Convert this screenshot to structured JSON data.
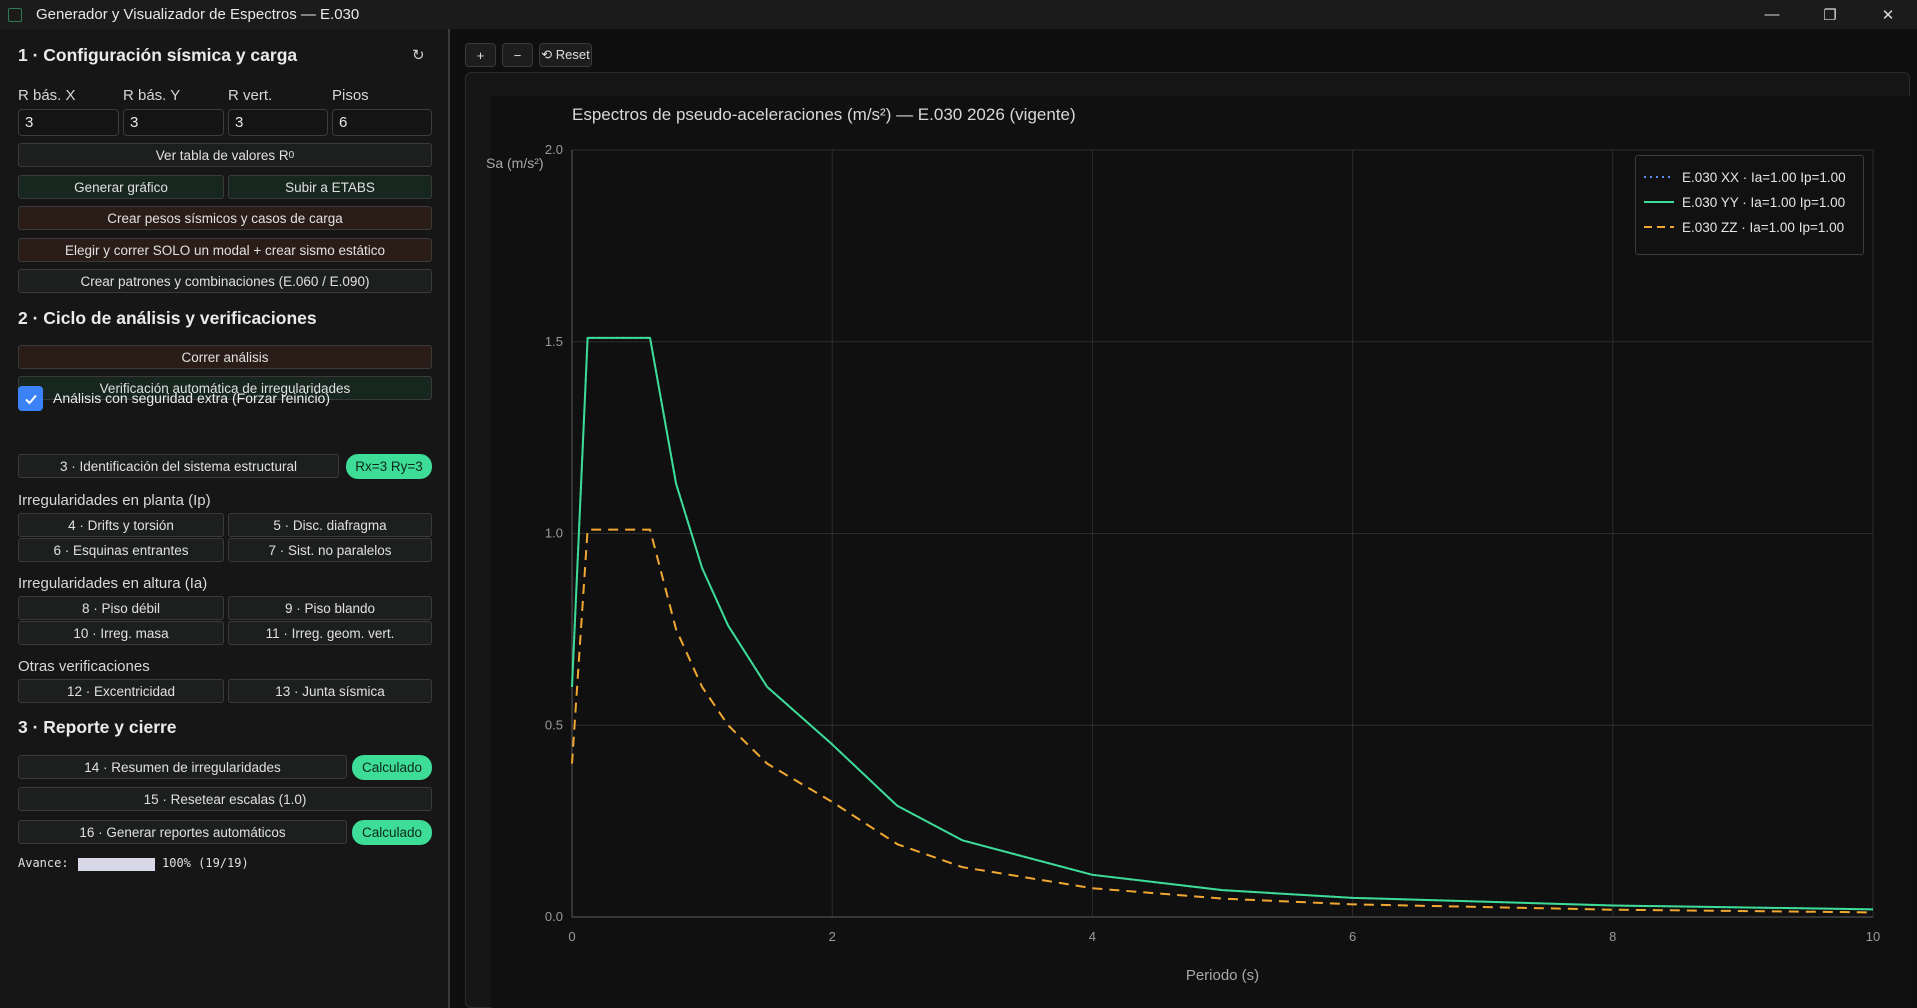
{
  "window": {
    "title": "Generador y Visualizador de Espectros — E.030",
    "controls": {
      "minimize": "—",
      "maximize": "❐",
      "close": "✕"
    }
  },
  "section1": {
    "title": "1 · Configuración sísmica y carga",
    "refresh_icon": "↻",
    "fields": [
      {
        "label": "R bás. X",
        "value": "3"
      },
      {
        "label": "R bás. Y",
        "value": "3"
      },
      {
        "label": "R vert.",
        "value": "3"
      },
      {
        "label": "Pisos",
        "value": "6"
      }
    ],
    "btn_table_text": "Ver tabla de valores R",
    "btn_table_sub": "0",
    "btn_generate": "Generar gráfico",
    "btn_etabs": "Subir a ETABS",
    "btn_weights": "Crear pesos sísmicos y casos de carga",
    "btn_modal": "Elegir y correr SOLO un modal + crear sismo estático",
    "btn_patterns": "Crear patrones y combinaciones (E.060 / E.090)"
  },
  "section2": {
    "title": "2 · Ciclo de análisis y verificaciones",
    "btn_run": "Correr análisis",
    "btn_auto": "Verificación automática de irregularidades",
    "checkbox_label": "Análisis con seguridad extra (Forzar reinicio)",
    "checkbox_checked": true,
    "btn_identify": "3 · Identificación del sistema estructural",
    "badge_r": "Rx=3 Ry=3",
    "plan_title": "Irregularidades en planta (Ip)",
    "plan_buttons": [
      "4 · Drifts y torsión",
      "5 · Disc. diafragma",
      "6 · Esquinas entrantes",
      "7 · Sist. no paralelos"
    ],
    "height_title": "Irregularidades en altura (Ia)",
    "height_buttons": [
      "8 · Piso débil",
      "9 · Piso blando",
      "10 · Irreg. masa",
      "11 · Irreg. geom. vert."
    ],
    "other_title": "Otras verificaciones",
    "other_buttons": [
      "12 · Excentricidad",
      "13 · Junta sísmica"
    ]
  },
  "section3": {
    "title": "3 · Reporte y cierre",
    "btn_summary": "14 · Resumen de irregularidades",
    "badge_summary": "Calculado",
    "btn_reset": "15 · Resetear escalas (1.0)",
    "btn_reports": "16 · Generar reportes automáticos",
    "badge_reports": "Calculado",
    "progress_label": "Avance:",
    "progress_fraction": 1.0,
    "progress_text": "100% (19/19)"
  },
  "toolbar": {
    "zoom_in": "+",
    "zoom_out": "−",
    "reset": "⟲ Reset"
  },
  "colors": {
    "xx": "#5b8def",
    "yy": "#3ddc97",
    "zz": "#f0a830",
    "accent": "#3b82f6",
    "badge": "#3ddc97"
  },
  "chart_data": {
    "type": "line",
    "title": "Espectros de pseudo-aceleraciones (m/s²) — E.030 2026 (vigente)",
    "xlabel": "Periodo (s)",
    "ylabel": "Sa (m/s²)",
    "xlim": [
      0,
      10
    ],
    "ylim": [
      0,
      2.0
    ],
    "xticks": [
      "0",
      "2",
      "4",
      "6",
      "8",
      "10"
    ],
    "yticks": [
      "0.0",
      "0.5",
      "1.0",
      "1.5",
      "2.0"
    ],
    "grid": true,
    "legend_position": "top-right",
    "series": [
      {
        "name": "E.030 XX  ·  Ia=1.00  Ip=1.00",
        "style": "dotted",
        "x": [
          0,
          0.12,
          0.6,
          0.8,
          1.0,
          1.2,
          1.5,
          2.0,
          2.5,
          3.0,
          4.0,
          5.0,
          6.0,
          8.0,
          10.0
        ],
        "y": [
          0.6,
          1.51,
          1.51,
          1.13,
          0.91,
          0.76,
          0.6,
          0.45,
          0.29,
          0.2,
          0.11,
          0.07,
          0.05,
          0.03,
          0.02
        ]
      },
      {
        "name": "E.030 YY  ·  Ia=1.00  Ip=1.00",
        "style": "solid",
        "x": [
          0,
          0.12,
          0.6,
          0.8,
          1.0,
          1.2,
          1.5,
          2.0,
          2.5,
          3.0,
          4.0,
          5.0,
          6.0,
          8.0,
          10.0
        ],
        "y": [
          0.6,
          1.51,
          1.51,
          1.13,
          0.91,
          0.76,
          0.6,
          0.45,
          0.29,
          0.2,
          0.11,
          0.07,
          0.05,
          0.03,
          0.02
        ]
      },
      {
        "name": "E.030 ZZ  ·  Ia=1.00  Ip=1.00",
        "style": "dashed",
        "x": [
          0,
          0.12,
          0.6,
          0.8,
          1.0,
          1.2,
          1.5,
          2.0,
          2.5,
          3.0,
          4.0,
          5.0,
          6.0,
          8.0,
          10.0
        ],
        "y": [
          0.4,
          1.01,
          1.01,
          0.75,
          0.6,
          0.5,
          0.4,
          0.3,
          0.19,
          0.13,
          0.075,
          0.048,
          0.033,
          0.019,
          0.012
        ]
      }
    ]
  }
}
